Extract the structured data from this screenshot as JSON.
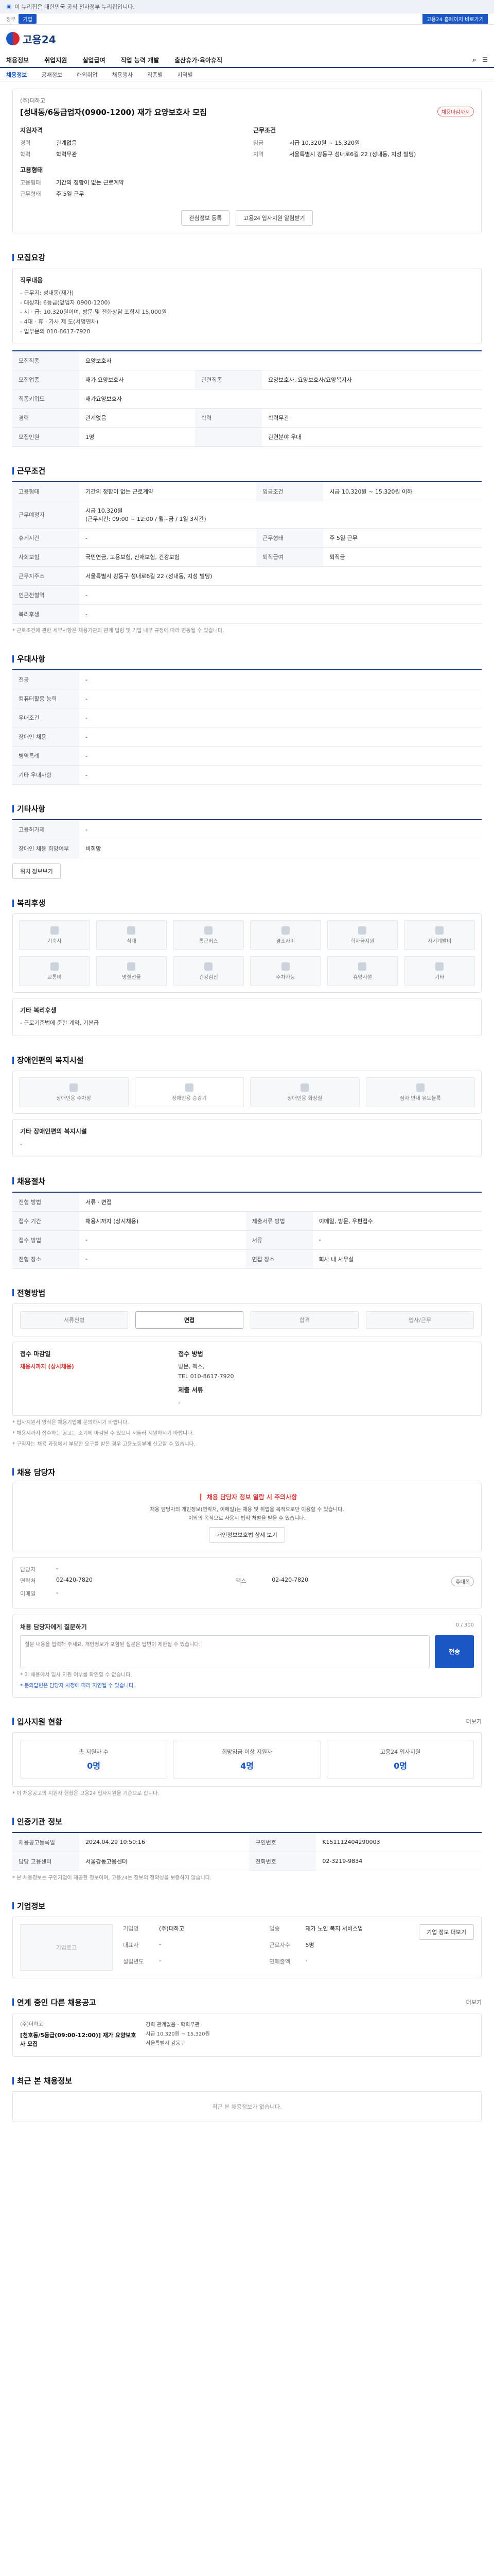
{
  "topbar": {
    "notice": "이 누리집은 대한민국 공식 전자정부 누리집입니다."
  },
  "subbar": {
    "gov": "정부",
    "gov_btn": "기업",
    "right": "고용24 홈페이지 바로가기"
  },
  "header": {
    "logo_text": "고용24"
  },
  "gnb": {
    "items": [
      "채용정보",
      "취업지원",
      "실업급여",
      "직업 능력 개발",
      "출산휴가·육아휴직"
    ]
  },
  "lnb": {
    "items": [
      "채용정보",
      "공채정보",
      "해외취업",
      "채용행사",
      "직종별",
      "지역별"
    ]
  },
  "job": {
    "company": "(주)더하고",
    "title": "[성내동/6동급업자(0900-1200) 재가 요양보호사 모집",
    "tag": "채용마감까지",
    "left_title": "지원자격",
    "right_title": "근무조건",
    "qual": [
      {
        "k": "경력",
        "v": "관계없음"
      },
      {
        "k": "학력",
        "v": "학력무관"
      }
    ],
    "cond": [
      {
        "k": "임금",
        "v": "시급 10,320원 ~ 15,320원"
      },
      {
        "k": "지역",
        "v": "서울특별시 강동구 성내로6길 22 (성내동, 지성 빌딩)"
      }
    ],
    "emp_title": "고용형태",
    "emp": [
      {
        "k": "고용형태",
        "v": "기간의 정함이 없는 근로계약"
      },
      {
        "k": "근무형태",
        "v": "주 5일 근무"
      }
    ],
    "btn_scrap": "관심정보 등록",
    "btn_share": "고용24 입사지원 알림받기"
  },
  "recruit": {
    "title": "모집요강",
    "desc_title": "직무내용",
    "desc": "- 근무지: 성내동(재가)\n- 대상자: 6등급(앞업자 0900-1200)\n- 시 · 급: 10,320원이며, 방문 및 전화상담 포함시 15,000원\n- 4대 · 휴 · 가사 제 도(서명연차)\n- 업무문의 010-8617-7920",
    "rows": [
      {
        "k": "모집직종",
        "v": "요양보호사",
        "k2": "",
        "v2": ""
      },
      {
        "k": "모집업종",
        "v": "재가 요양보호사",
        "k2": "관련직종",
        "v2": "요양보호사, 요양보호사/요양복지사"
      },
      {
        "k": "직종키워드",
        "v": "재가요양보호사",
        "k2": "",
        "v2": ""
      },
      {
        "k": "경력",
        "v": "관계없음",
        "k2": "학력",
        "v2": "학력무관"
      },
      {
        "k": "모집인원",
        "v": "1명",
        "k2": "",
        "v2": "관련분야 우대"
      }
    ]
  },
  "work": {
    "title": "근무조건",
    "rows": [
      {
        "k": "고용형태",
        "v": "기간의 정함이 없는 근로계약",
        "k2": "임금조건",
        "v2": "시급 10,320원 ~ 15,320원 이하"
      },
      {
        "k": "근무예정지",
        "v": "시급 10,320원\n(근무시간: 09:00 ~ 12:00 / 월~금 / 1일 3시간)",
        "k2": "",
        "v2": ""
      },
      {
        "k": "휴게시간",
        "v": "-",
        "k2": "근무형태",
        "v2": "주 5일 근무"
      },
      {
        "k": "사회보험",
        "v": "국민연금, 고용보험, 산재보험, 건강보험",
        "k2": "퇴직급여",
        "v2": "퇴직금"
      },
      {
        "k": "근무지주소",
        "v": "서울특별시 강동구 성내로6길 22 (성내동, 지성 빌딩)",
        "k2": "",
        "v2": ""
      },
      {
        "k": "인근전철역",
        "v": "-",
        "k2": "",
        "v2": ""
      },
      {
        "k": "복리후생",
        "v": "-",
        "k2": "",
        "v2": ""
      }
    ],
    "note": "* 근로조건에 관한 세부사항은 채용기관의 관계 법령 및 기업 내부 규정에 따라 변동될 수 있습니다."
  },
  "prefs": {
    "title": "우대사항",
    "rows": [
      {
        "k": "전공",
        "v": "-"
      },
      {
        "k": "컴퓨터활용 능력",
        "v": "-"
      },
      {
        "k": "우대조건",
        "v": "-"
      },
      {
        "k": "장애인 채용",
        "v": "-"
      },
      {
        "k": "병역특례",
        "v": "-"
      },
      {
        "k": "기타 우대사항",
        "v": "-"
      }
    ]
  },
  "misc": {
    "title": "기타사항",
    "rows": [
      {
        "k": "고용허가제",
        "v": "-"
      },
      {
        "k": "장애인 채용 희망여부",
        "v": "비희망"
      }
    ],
    "link": "위치 정보보기"
  },
  "benefits": {
    "title": "복리후생",
    "items": [
      "기숙사",
      "식대",
      "통근버스",
      "경조사비",
      "학자금지원",
      "자기계발비",
      "교통비",
      "명절선물",
      "건강검진",
      "주차가능",
      "휴양시설",
      "기타"
    ],
    "extra_title": "기타 복리후생",
    "extra": "- 근로기준법에 준한 계약, 기본급"
  },
  "disability": {
    "title": "장애인편의 복지시설",
    "items": [
      "장애인용 주차장",
      "장애인용 승강기",
      "장애인용 화장실",
      "점자 안내 유도블록"
    ],
    "extra_title": "기타 장애인편의 복지시설",
    "extra": "-"
  },
  "hire": {
    "title": "채용절차",
    "rows": [
      {
        "k": "전형 방법",
        "v": "서류 · 면접",
        "k2": "",
        "v2": ""
      },
      {
        "k": "접수 기간",
        "v": "채용시까지 (상시채용)",
        "k2": "제출서류 방법",
        "v2": "이메일, 방문, 우편접수"
      },
      {
        "k": "접수 방법",
        "v": "-",
        "k2": "서류",
        "v2": "-"
      },
      {
        "k": "전형 장소",
        "v": "-",
        "k2": "면접 장소",
        "v2": "회사 내 사무실"
      }
    ]
  },
  "steps": {
    "title": "전형방법",
    "items": [
      "서류전형",
      "면접",
      "합격",
      "입사/근무"
    ],
    "active": 1,
    "left_title": "접수 마감일",
    "left_value": "채용시까지 (상시채용)",
    "right_title": "접수 방법",
    "right_values": [
      "방문, 팩스,",
      "TEL 010-8617-7920"
    ],
    "right_sub": "제출 서류",
    "right_sub_value": "-",
    "notes": [
      "* 입사지원서 양식은 채용기업에 문의하시기 바랍니다.",
      "* 채용시까지 접수하는 공고는 조기에 마감될 수 있으니 서둘러 지원하시기 바랍니다.",
      "* 구직자는 채용 과정에서 부당한 요구를 받은 경우 고용노동부에 신고할 수 있습니다."
    ]
  },
  "manager": {
    "title": "채용 담당자",
    "warn_title": "채용 담당자 정보 열람 시 주의사항",
    "warn_lines": [
      "채용 담당자의 개인정보(연락처, 이메일)는 채용 및 취업을 목적으로만 이용할 수 있습니다.",
      "이외의 목적으로 사용시 법적 처벌을 받을 수 있습니다.",
      "개인정보보호법 상세 보기"
    ],
    "name_label": "담당자",
    "name_value": "-",
    "tel_label": "연락처",
    "tel_value": "02-420-7820",
    "fax_label": "팩스",
    "fax_value": "02-420-7820",
    "email_label": "이메일",
    "email_value": "-",
    "badge": "휴대폰",
    "qa_title": "채용 담당자에게 질문하기",
    "qa_count": "0 / 300",
    "qa_placeholder": "질문 내용을 입력해 주세요. 개인정보가 포함된 질문은 답변이 제한될 수 있습니다.",
    "qa_send": "전송",
    "qa_notes": [
      "* 이 채용에서 입사 지원 여부를 확인할 수 없습니다.",
      "* 문의답변은 담당자 사정에 따라 지연될 수 있습니다."
    ]
  },
  "applicants": {
    "title": "입사지원 현황",
    "more": "더보기",
    "items": [
      {
        "label": "총 지원자 수",
        "value": "0명"
      },
      {
        "label": "희망임금 이상 지원자",
        "value": "4명"
      },
      {
        "label": "고용24 입사지원",
        "value": "0명"
      }
    ],
    "note": "* 이 채용공고의 지원자 현황은 고용24 입사지원을 기준으로 합니다."
  },
  "agency": {
    "title": "인증기관 정보",
    "rows": [
      {
        "k": "채용공고등록일",
        "v": "2024.04.29 10:50:16",
        "k2": "구인번호",
        "v2": "K151112404290003"
      },
      {
        "k": "담당 고용센터",
        "v": "서울강동고용센터",
        "k2": "전화번호",
        "v2": "02-3219-9834"
      }
    ],
    "note": "* 본 채용정보는 구인기업이 제공한 정보이며, 고용24는 정보의 정확성을 보증하지 않습니다."
  },
  "company": {
    "title": "기업정보",
    "logo": "기업로고",
    "rows": [
      {
        "k": "기업명",
        "v": "(주)더하고"
      },
      {
        "k": "업종",
        "v": "재가 노인 복지 서비스업"
      },
      {
        "k": "대표자",
        "v": "-"
      },
      {
        "k": "근로자수",
        "v": "5명"
      },
      {
        "k": "설립년도",
        "v": "-"
      },
      {
        "k": "연매출액",
        "v": "-"
      }
    ],
    "btn": "기업 정보 더보기"
  },
  "related": {
    "title": "연계 중인 다른 채용공고",
    "more": "더보기",
    "company": "(주)더하고",
    "job": "[천호동/5등급(09:00-12:00)] 재가 요양보호사 모집",
    "meta": [
      "경력 관계없음 · 학력무관",
      "시급 10,320원 ~ 15,320원",
      "서울특별시 강동구"
    ]
  },
  "viewed": {
    "title": "최근 본 채용정보",
    "empty": "최근 본 채용정보가 없습니다."
  }
}
